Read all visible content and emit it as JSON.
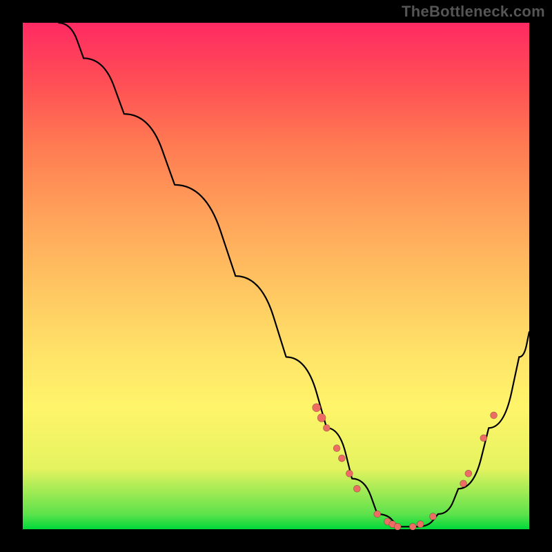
{
  "watermark": "TheBottleneck.com",
  "colors": {
    "background": "#000000",
    "curve_stroke": "#000000",
    "dot_fill": "#ed6d64",
    "gradient_top": "#ff2a62",
    "gradient_bottom": "#00d93a"
  },
  "chart_data": {
    "type": "line",
    "title": "",
    "xlabel": "",
    "ylabel": "",
    "xlim": [
      0,
      100
    ],
    "ylim": [
      0,
      100
    ],
    "grid": false,
    "legend": false,
    "curve": [
      {
        "x": 7,
        "y": 100
      },
      {
        "x": 12,
        "y": 93
      },
      {
        "x": 20,
        "y": 82
      },
      {
        "x": 30,
        "y": 68
      },
      {
        "x": 42,
        "y": 50
      },
      {
        "x": 52,
        "y": 34
      },
      {
        "x": 60,
        "y": 20
      },
      {
        "x": 65,
        "y": 10
      },
      {
        "x": 70,
        "y": 3
      },
      {
        "x": 74,
        "y": 0.5
      },
      {
        "x": 78,
        "y": 0.5
      },
      {
        "x": 82,
        "y": 3
      },
      {
        "x": 86,
        "y": 8
      },
      {
        "x": 92,
        "y": 20
      },
      {
        "x": 98,
        "y": 34
      },
      {
        "x": 100,
        "y": 39
      }
    ],
    "points_on_curve": [
      {
        "x": 58,
        "y": 24,
        "r": 6
      },
      {
        "x": 59,
        "y": 22,
        "r": 6
      },
      {
        "x": 60,
        "y": 20,
        "r": 5
      },
      {
        "x": 62,
        "y": 16,
        "r": 5
      },
      {
        "x": 63,
        "y": 14,
        "r": 5
      },
      {
        "x": 64.5,
        "y": 11,
        "r": 5
      },
      {
        "x": 66,
        "y": 8,
        "r": 5
      },
      {
        "x": 70,
        "y": 3,
        "r": 5
      },
      {
        "x": 72,
        "y": 1.5,
        "r": 5
      },
      {
        "x": 73,
        "y": 1,
        "r": 5
      },
      {
        "x": 74,
        "y": 0.5,
        "r": 5
      },
      {
        "x": 77,
        "y": 0.5,
        "r": 5
      },
      {
        "x": 78.5,
        "y": 1,
        "r": 5
      },
      {
        "x": 81,
        "y": 2.5,
        "r": 5
      },
      {
        "x": 87,
        "y": 9,
        "r": 5
      },
      {
        "x": 88,
        "y": 11,
        "r": 5
      },
      {
        "x": 91,
        "y": 18,
        "r": 5
      },
      {
        "x": 93,
        "y": 22.5,
        "r": 5
      }
    ],
    "annotations": []
  }
}
